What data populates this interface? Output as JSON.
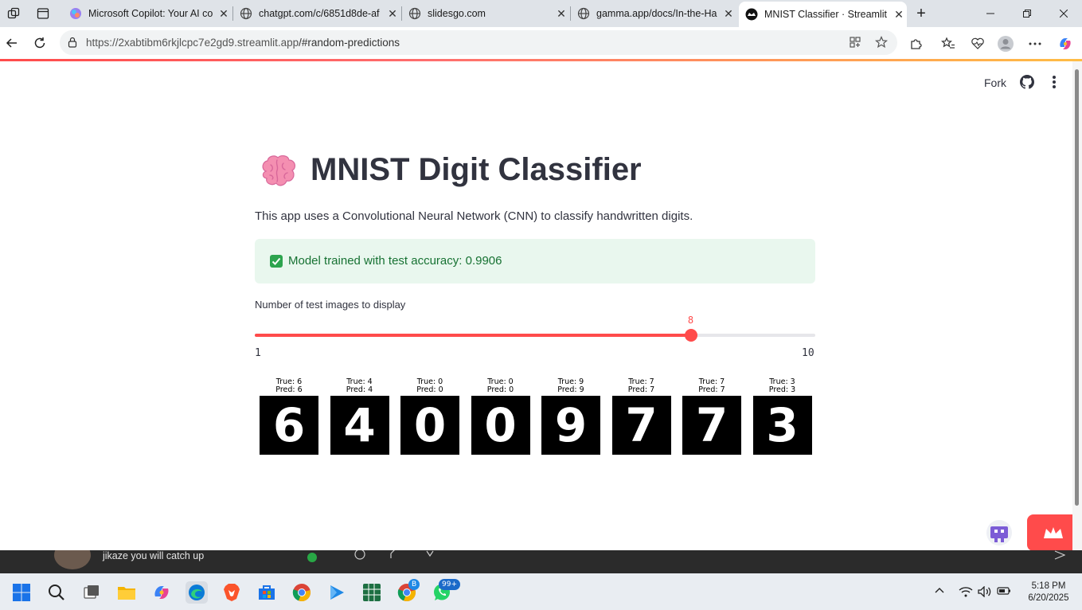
{
  "browser": {
    "tabs": [
      {
        "title": "Microsoft Copilot: Your AI co",
        "favicon": "copilot-icon"
      },
      {
        "title": "chatgpt.com/c/6851d8de-af",
        "favicon": "globe-icon"
      },
      {
        "title": "slidesgo.com",
        "favicon": "globe-icon"
      },
      {
        "title": "gamma.app/docs/In-the-Ha",
        "favicon": "globe-icon"
      },
      {
        "title": "MNIST Classifier · Streamlit",
        "favicon": "streamlit-icon",
        "active": true
      }
    ],
    "url_host": "https://2xabtibm6rkjlcpc7e2gd9.streamlit.app",
    "url_path": "/#random-predictions"
  },
  "app": {
    "header": {
      "fork_label": "Fork"
    },
    "title_emoji": "brain-emoji",
    "title": "MNIST Digit Classifier",
    "description": "This app uses a Convolutional Neural Network (CNN) to classify handwritten digits.",
    "success_message": "Model trained with test accuracy: 0.9906",
    "slider": {
      "label": "Number of test images to display",
      "min": 1,
      "max": 10,
      "value": 8,
      "min_label": "1",
      "max_label": "10",
      "value_label": "8"
    },
    "predictions": [
      {
        "true_label": "True: 6",
        "pred_label": "Pred: 6",
        "digit": "6"
      },
      {
        "true_label": "True: 4",
        "pred_label": "Pred: 4",
        "digit": "4"
      },
      {
        "true_label": "True: 0",
        "pred_label": "Pred: 0",
        "digit": "0"
      },
      {
        "true_label": "True: 0",
        "pred_label": "Pred: 0",
        "digit": "0"
      },
      {
        "true_label": "True: 9",
        "pred_label": "Pred: 9",
        "digit": "9"
      },
      {
        "true_label": "True: 7",
        "pred_label": "Pred: 7",
        "digit": "7"
      },
      {
        "true_label": "True: 7",
        "pred_label": "Pred: 7",
        "digit": "7"
      },
      {
        "true_label": "True: 3",
        "pred_label": "Pred: 3",
        "digit": "3"
      }
    ],
    "colors": {
      "accent": "#ff4b4b",
      "success_bg": "#e9f7ee",
      "success_text": "#177233",
      "text": "#31333f"
    }
  },
  "notification": {
    "text": "jikaze you will catch up",
    "badge": "1"
  },
  "taskbar": {
    "badges": {
      "chrome_profile": "B",
      "whatsapp": "99+"
    },
    "time": "5:18 PM",
    "date": "6/20/2025"
  }
}
